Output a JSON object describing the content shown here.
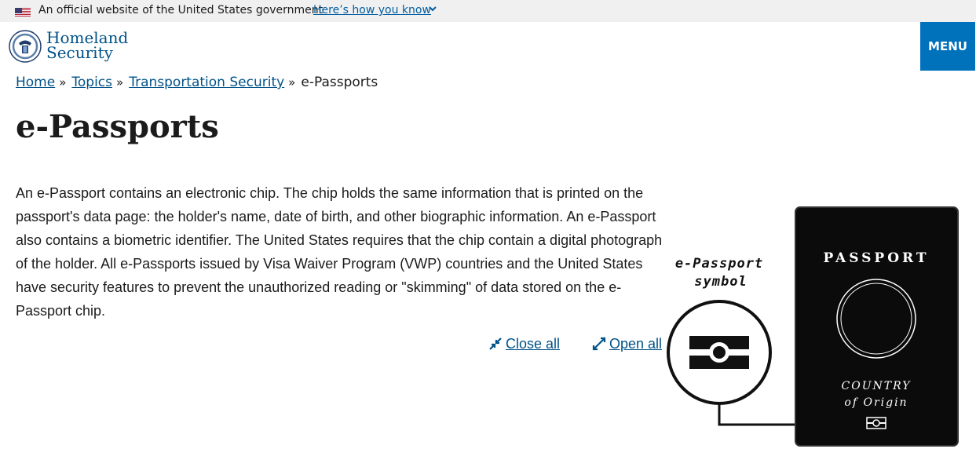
{
  "gov_banner": {
    "text": "An official website of the United States government",
    "link": "Here’s how you know"
  },
  "header": {
    "logo_line1": "Homeland",
    "logo_line2": "Security",
    "menu_label": "MENU"
  },
  "breadcrumb": {
    "items": [
      "Home",
      "Topics",
      "Transportation Security"
    ],
    "separator": "»",
    "current": "e-Passports"
  },
  "page": {
    "title": "e-Passports",
    "intro": "An e-Passport contains an electronic chip. The chip holds the same information that is printed on the passport's data page: the holder's name, date of birth, and other biographic information. An e-Passport also contains a biometric identifier. The United States requires that the chip contain a digital photograph of the holder. All e-Passports issued by Visa Waiver Program (VWP) countries and the United States have security features to prevent the unauthorized reading or \"skimming\" of data stored on the e-Passport chip."
  },
  "accordion_controls": {
    "close_all": "Close all",
    "open_all": "Open all"
  },
  "illustration": {
    "symbol_label_1": "e-Passport",
    "symbol_label_2": "symbol",
    "passport_title": "PASSPORT",
    "country_line1": "COUNTRY",
    "country_line2": "of Origin"
  },
  "colors": {
    "link": "#005288",
    "menu_bg": "#0071bb",
    "banner_bg": "#f0f0f0"
  }
}
